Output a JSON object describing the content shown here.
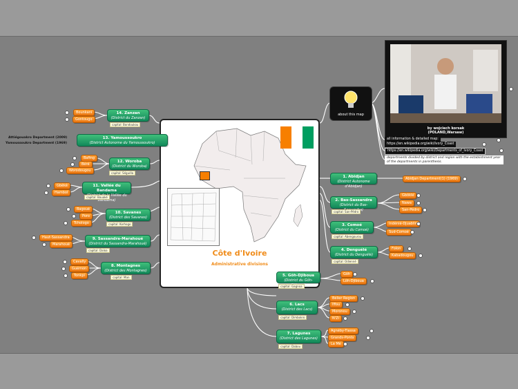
{
  "central": {
    "title": "Côte d'Ivoire",
    "subtitle": "Administrative divisions"
  },
  "about": {
    "label": "about this map"
  },
  "author": {
    "name": "by wojciech korsak",
    "location": "(POLAND,Warsaw)"
  },
  "info": {
    "line1": "all information & detailed map:",
    "link1": "https://en.wikipedia.org/wiki/Ivory_Coast",
    "link2": "https://en.wikipedia.org/wiki/Departments_of_Ivory_Coast",
    "note": "departments divided by district and region with the establishment year of the departments in parenthesis."
  },
  "districts": [
    {
      "num": "1. Abidjan",
      "sub": "(District Autonome d'Abidjan)",
      "children": [
        "Abidjan Department(1) (1969)"
      ]
    },
    {
      "num": "2. Bas-Sassandra",
      "sub": "(District du Bas-Sassandra)",
      "capital": "capital: San-Pédro",
      "children": [
        "Gbôklé",
        "Nawa",
        "San-Pédro"
      ]
    },
    {
      "num": "3. Comoé",
      "sub": "(District du Comoé)",
      "capital": "capital: Abengourou",
      "children": [
        "Indénié-Djuablin",
        "Sud-Comoé"
      ]
    },
    {
      "num": "4. Denguélé",
      "sub": "(District du Denguélé)",
      "capital": "capital: Odienné",
      "children": [
        "Folon",
        "Kabadougou"
      ]
    },
    {
      "num": "5. Gôh-Djiboua",
      "sub": "(District du Gôh-Djiboua)",
      "capital": "capital: Gagnoa",
      "children": [
        "Gôh",
        "Lôh-Djiboua"
      ]
    },
    {
      "num": "6. Lacs",
      "sub": "(District des Lacs)",
      "capital": "capital: Dimbokro",
      "children": [
        "Bélier Region",
        "Iffou",
        "Moronou",
        "N'Zi"
      ]
    },
    {
      "num": "7. Lagunes",
      "sub": "(District des Lagunes)",
      "capital": "capital: Dabou",
      "children": [
        "Agnéby-Tiassa",
        "Grands-Ponts",
        "La Mé"
      ]
    },
    {
      "num": "8. Montagnes",
      "sub": "(District des Montagnes)",
      "capital": "capital: Man",
      "children": [
        "Cavally",
        "Guémon",
        "Tonkpi"
      ]
    },
    {
      "num": "9. Sassandra-Marahoué",
      "sub": "(District du Sassandra-Marahoué)",
      "capital": "capital: Daloa",
      "children": [
        "Haut-Sassandra",
        "Marahoué"
      ]
    },
    {
      "num": "10. Savanes",
      "sub": "(District des Savanes)",
      "capital": "capital: Korhogo",
      "children": [
        "Bagoué",
        "Poro",
        "Tchologo"
      ]
    },
    {
      "num": "11. Vallée du Bandama",
      "sub": "(District de la Vallée du Bandama)",
      "capital": "capital: Bouaké",
      "children": [
        "Gbêkê",
        "Hambol"
      ]
    },
    {
      "num": "12. Woroba",
      "sub": "(District du Woroba)",
      "capital": "capital: Séguéla",
      "children": [
        "Bafing",
        "Béré",
        "Worodougou"
      ]
    },
    {
      "num": "13. Yamoussoukro",
      "sub": "(District Autonome du Yamoussoukro)",
      "children": [
        "Attiégouakro Department (2009)",
        "Yamoussoukro Department (1969)"
      ]
    },
    {
      "num": "14. Zanzan",
      "sub": "(District du Zanzan)",
      "capital": "capital: Bondoukou",
      "children": [
        "Bounkani",
        "Gontougo"
      ]
    }
  ],
  "colors": {
    "background": "#808080",
    "node_green": "#1fa36a",
    "node_orange": "#f58a1f",
    "title": "#f08c1a",
    "flag_orange": "#f77f00",
    "flag_white": "#ffffff",
    "flag_green": "#009e60"
  },
  "icons": {
    "about": "lightbulb-icon"
  }
}
